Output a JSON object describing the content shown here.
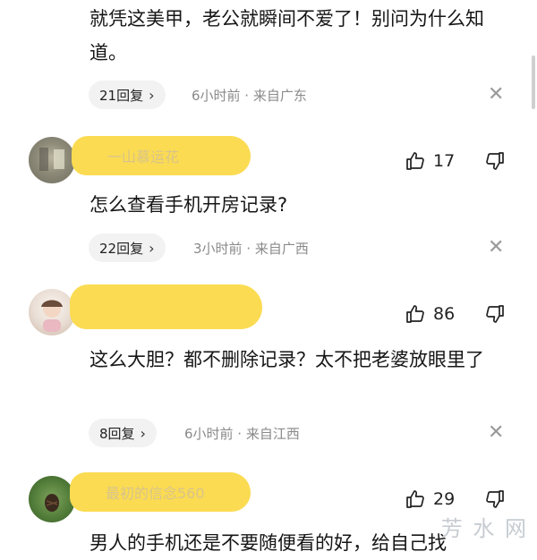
{
  "top_comment": {
    "text": "就凭这美甲，老公就瞬间不爱了！别问为什么知道。",
    "reply_label": "21回复",
    "meta": "6小时前 · 来自广东"
  },
  "comments": [
    {
      "username": "一山慕运花",
      "likes": "17",
      "text": "怎么查看手机开房记录?",
      "reply_label": "22回复",
      "meta": "3小时前 · 来自广西"
    },
    {
      "username": "",
      "likes": "86",
      "text": "这么大胆？都不删除记录？太不把老婆放眼里了",
      "reply_label": "8回复",
      "meta": "6小时前 · 来自江西"
    },
    {
      "username": "最初的信念560",
      "likes": "29",
      "text": "男人的手机还是不要随便看的好，给自己找"
    }
  ],
  "watermark": "芳 水 网",
  "icons": {
    "like": "thumbs-up-icon",
    "dislike": "thumbs-down-icon",
    "close": "close-icon",
    "chevron": "chevron-right-icon"
  },
  "colors": {
    "pill_bg": "#f2f2f2",
    "highlight": "#fbdb52",
    "meta": "#8a8a8a"
  }
}
